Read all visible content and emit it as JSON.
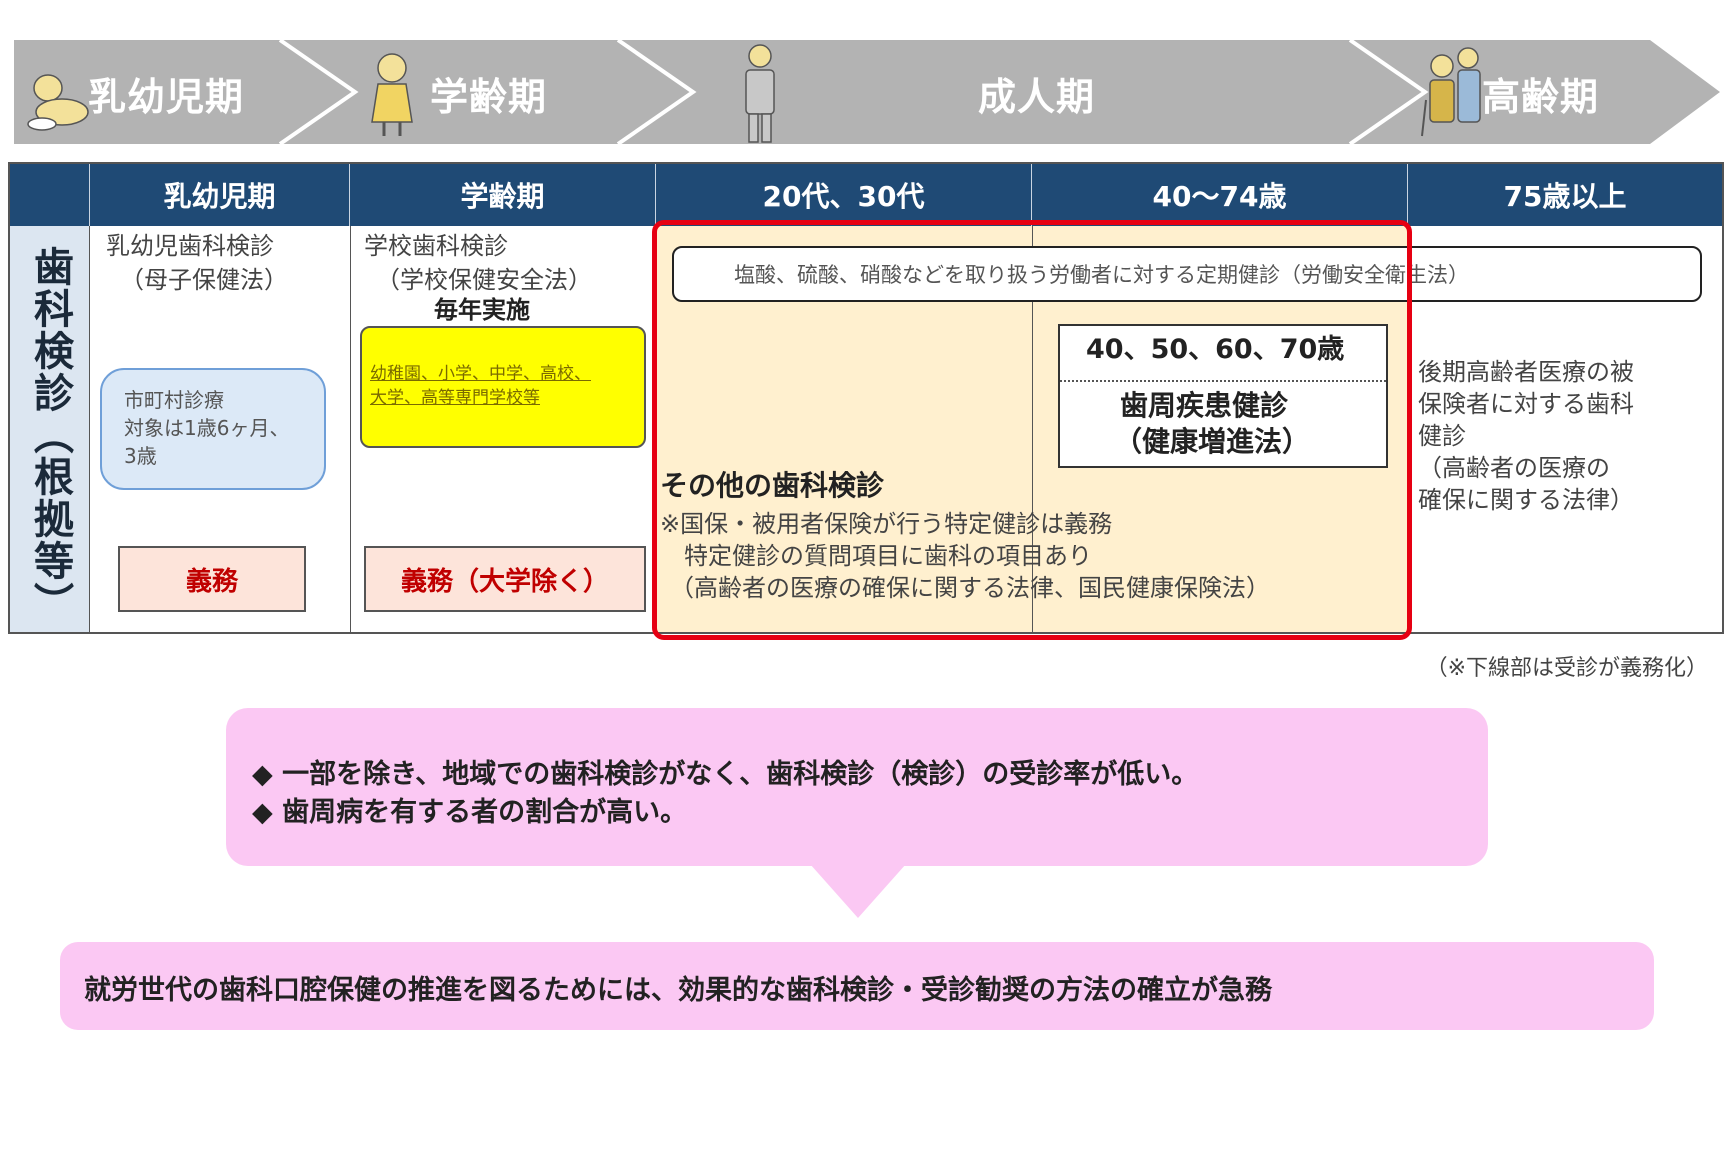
{
  "stages": [
    "乳幼児期",
    "学齢期",
    "成人期",
    "高齢期"
  ],
  "table": {
    "row_label": "歯科検診（根拠等）",
    "headers": [
      "乳幼児期",
      "学齢期",
      "20代、30代",
      "40〜74歳",
      "75歳以上"
    ],
    "infant": {
      "exam": "乳幼児歯科検診",
      "law": "（母子保健法）",
      "municipal_lines": [
        "市町村診療",
        "対象は1歳6ヶ月、",
        "3歳"
      ],
      "duty": "義務"
    },
    "school": {
      "exam": "学校歯科検診",
      "law": "（学校保健安全法）",
      "annual": "毎年実施",
      "schools_lines": [
        "幼稚園、小学、中学、高校、",
        "大学、高等専門学校等"
      ],
      "duty": "義務（大学除く）"
    },
    "worker_exam": "塩酸、硫酸、硝酸などを取り扱う労働者に対する定期健診（労働安全衛生法）",
    "periodontal": {
      "ages": "40、50、60、70歳",
      "title": "歯周疾患健診",
      "law": "（健康増進法）"
    },
    "other": {
      "title": "その他の歯科検診",
      "lines": [
        "※国保・被用者保険が行う特定健診は義務",
        "　特定健診の質問項目に歯科の項目あり",
        "（高齢者の医療の確保に関する法律、国民健康保険法）"
      ]
    },
    "elderly_lines": [
      "後期高齢者医療の被",
      "保険者に対する歯科",
      "健診",
      "（高齢者の医療の",
      "確保に関する法律）"
    ]
  },
  "footnote": "（※下線部は受診が義務化）",
  "issues": [
    "◆ 一部を除き、地域での歯科検診がなく、歯科検診（検診）の受診率が低い。",
    "◆ 歯周病を有する者の割合が高い。"
  ],
  "conclusion": "就労世代の歯科口腔保健の推進を図るためには、効果的な歯科検診・受診勧奨の方法の確立が急務",
  "colors": {
    "arrow_gray": "#b3b3b3",
    "header_navy": "#1f4a75",
    "highlight_red": "#e60012",
    "adult_zone": "#fff0cf",
    "duty_fill": "#fde4da",
    "school_yellow": "#ffff00",
    "bubble_pink": "#fbc8f3",
    "side_blue": "#dce6f1"
  }
}
